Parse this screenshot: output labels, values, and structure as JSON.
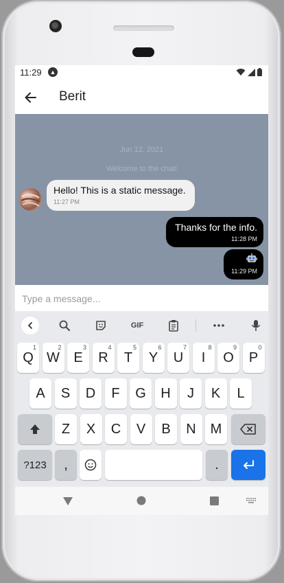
{
  "status": {
    "time": "11:29"
  },
  "header": {
    "title": "Berit"
  },
  "chat": {
    "date": "Jun 12, 2021",
    "system_message": "Welcome to the chat!",
    "messages": [
      {
        "direction": "incoming",
        "text": "Hello! This is a static message.",
        "time": "11:27 PM"
      },
      {
        "direction": "outgoing",
        "text": "Thanks for the info.",
        "time": "11:28 PM"
      },
      {
        "direction": "outgoing",
        "icon": "robot-emoji",
        "time": "11:29 PM"
      }
    ]
  },
  "composer": {
    "placeholder": "Type a message...",
    "value": ""
  },
  "keyboard": {
    "toolbar": {
      "gif_label": "GIF"
    },
    "row1": [
      {
        "k": "Q",
        "h": "1"
      },
      {
        "k": "W",
        "h": "2"
      },
      {
        "k": "E",
        "h": "3"
      },
      {
        "k": "R",
        "h": "4"
      },
      {
        "k": "T",
        "h": "5"
      },
      {
        "k": "Y",
        "h": "6"
      },
      {
        "k": "U",
        "h": "7"
      },
      {
        "k": "I",
        "h": "8"
      },
      {
        "k": "O",
        "h": "9"
      },
      {
        "k": "P",
        "h": "0"
      }
    ],
    "row2": [
      "A",
      "S",
      "D",
      "F",
      "G",
      "H",
      "J",
      "K",
      "L"
    ],
    "row3": [
      "Z",
      "X",
      "C",
      "V",
      "B",
      "N",
      "M"
    ],
    "symbols_label": "?123",
    "comma_label": ",",
    "period_label": "."
  },
  "colors": {
    "chat_bg": "#8694a6",
    "incoming_bubble": "#f1f1f1",
    "outgoing_bubble": "#000000",
    "enter_key": "#1a73e8"
  }
}
